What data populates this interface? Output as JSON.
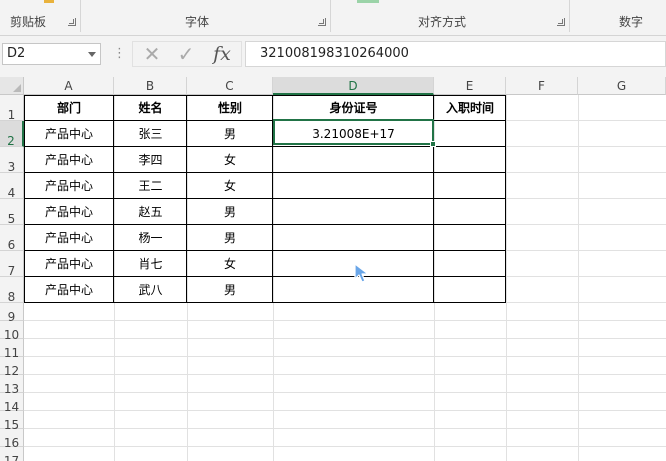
{
  "ribbon": {
    "groups": [
      {
        "label": "剪贴板"
      },
      {
        "label": "字体"
      },
      {
        "label": "对齐方式"
      },
      {
        "label": "数字"
      }
    ]
  },
  "formula_bar": {
    "name_box": "D2",
    "formula": "321008198310264000",
    "fx_label": "fx",
    "cancel_icon": "✕",
    "enter_icon": "✓"
  },
  "columns": [
    "A",
    "B",
    "C",
    "D",
    "E",
    "F",
    "G"
  ],
  "active_column": "D",
  "row_numbers": [
    "1",
    "2",
    "3",
    "4",
    "5",
    "6",
    "7",
    "8",
    "9",
    "10",
    "11",
    "12",
    "13",
    "14",
    "15",
    "16",
    "17"
  ],
  "active_row": "2",
  "table": {
    "headers": [
      "部门",
      "姓名",
      "性别",
      "身份证号",
      "入职时间"
    ],
    "rows": [
      [
        "产品中心",
        "张三",
        "男",
        "3.21008E+17",
        ""
      ],
      [
        "产品中心",
        "李四",
        "女",
        "",
        ""
      ],
      [
        "产品中心",
        "王二",
        "女",
        "",
        ""
      ],
      [
        "产品中心",
        "赵五",
        "男",
        "",
        ""
      ],
      [
        "产品中心",
        "杨一",
        "男",
        "",
        ""
      ],
      [
        "产品中心",
        "肖七",
        "女",
        "",
        ""
      ],
      [
        "产品中心",
        "武八",
        "男",
        "",
        ""
      ]
    ]
  },
  "colors": {
    "accent": "#217346",
    "cursor": "#6aa6e8"
  }
}
